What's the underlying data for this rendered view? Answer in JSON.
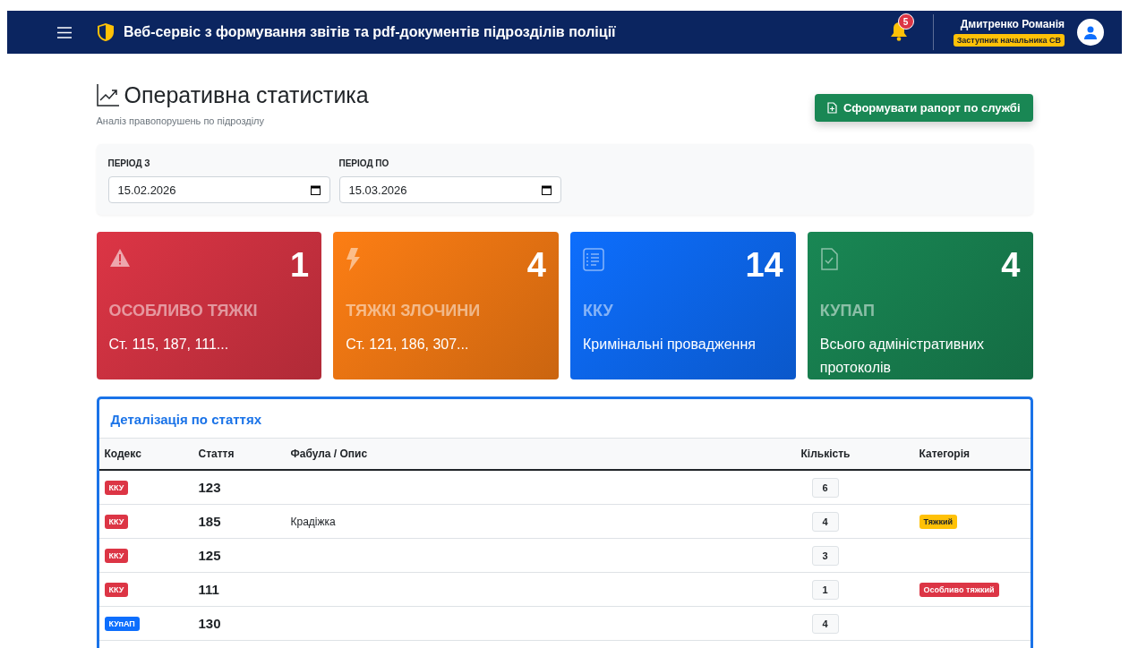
{
  "navbar": {
    "title": "Веб-сервіс з формування звітів та pdf-документів підрозділів поліції",
    "notifications": "5",
    "user": {
      "name": "Дмитренко Романія",
      "role": "Заступник начальника СВ"
    }
  },
  "header": {
    "title": "Оперативна статистика",
    "subtitle": "Аналіз правопорушень по підрозділу",
    "button": "Сформувати рапорт по службі"
  },
  "filters": [
    {
      "label": "ПЕРІОД З",
      "value": "15.02.2026"
    },
    {
      "label": "ПЕРІОД ПО",
      "value": "15.03.2026"
    }
  ],
  "stats": [
    {
      "kind": "warning",
      "count": "1",
      "title": "ОСОБЛИВО ТЯЖКІ",
      "text": "Ст. 115, 187, 111...",
      "color": "#dc3545"
    },
    {
      "kind": "lightning",
      "count": "4",
      "title": "ТЯЖКІ ЗЛОЧИНИ",
      "text": "Ст. 121, 186, 307...",
      "color": "#fd7e14"
    },
    {
      "kind": "list",
      "count": "14",
      "title": "ККУ",
      "text": "Кримінальні провадження",
      "color": "#0d6efd"
    },
    {
      "kind": "document",
      "count": "4",
      "title": "КУПАП",
      "text": "Всього адміністративних протоколів",
      "color": "#198754"
    }
  ],
  "table": {
    "title": "Деталізація по статтях",
    "columns": [
      "Кодекс",
      "Стаття",
      "Фабула / Опис",
      "Кількість",
      "Категорія"
    ],
    "rows": [
      {
        "code": {
          "text": "ККУ",
          "color": "#dc3545"
        },
        "article": "123",
        "count": "6"
      },
      {
        "code": {
          "text": "ККУ",
          "color": "#dc3545"
        },
        "article": "185",
        "description": "Крадіжка",
        "count": "4",
        "category": {
          "text": "Тяжкий",
          "color": "#ffc107"
        }
      },
      {
        "code": {
          "text": "ККУ",
          "color": "#dc3545"
        },
        "article": "125",
        "count": "3"
      },
      {
        "code": {
          "text": "ККУ",
          "color": "#dc3545"
        },
        "article": "111",
        "count": "1",
        "category": {
          "text": "Особливо тяжкий",
          "color": "#dc3545"
        }
      },
      {
        "code": {
          "text": "КУпАП",
          "color": "#0d6efd"
        },
        "article": "130",
        "count": "4"
      }
    ]
  }
}
